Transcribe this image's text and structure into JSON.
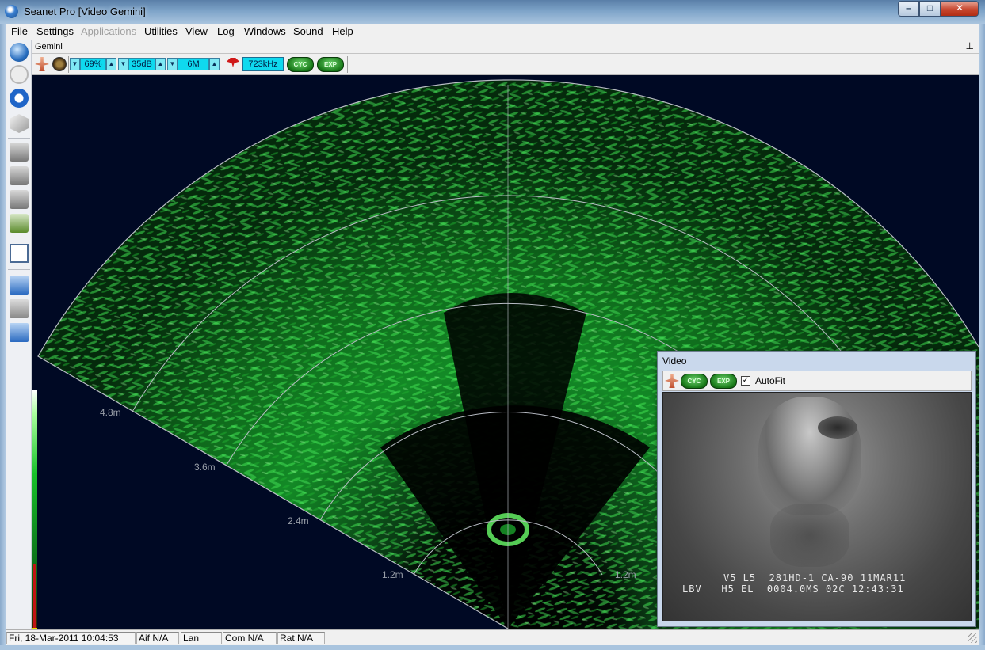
{
  "window": {
    "title": "Seanet Pro [Video Gemini]",
    "min_glyph": "–",
    "max_glyph": "□",
    "close_glyph": "✕"
  },
  "menu": {
    "file": "File",
    "settings": "Settings",
    "applications": "Applications",
    "utilities": "Utilities",
    "view": "View",
    "log": "Log",
    "windows": "Windows",
    "sound": "Sound",
    "help": "Help"
  },
  "left_toolbar": {
    "icons": [
      "globe-icon",
      "disabled-circle-icon",
      "blue-ring-icon",
      "cube-icon",
      "printer-icon",
      "printer-icon",
      "printer-icon",
      "printer-config-icon",
      "window-icon",
      "monitor-icon",
      "monitor-icon",
      "monitor-icon"
    ]
  },
  "gemini": {
    "panel_title": "Gemini",
    "pin_glyph": "⊥",
    "gain": "69%",
    "db": "35dB",
    "range": "6M",
    "frequency": "723kHz",
    "cyc_label": "CYC",
    "exp_label": "EXP",
    "spin_up": "▲",
    "spin_down": "▼"
  },
  "sonar": {
    "range_labels_left": [
      "4.8m",
      "3.6m",
      "2.4m",
      "1.2m"
    ],
    "range_labels_right": [
      "1.2m"
    ],
    "colors": {
      "background": "#000924",
      "echo": "#18c22a",
      "grid": "#b8bcc4"
    }
  },
  "video": {
    "title": "Video",
    "cyc_label": "CYC",
    "exp_label": "EXP",
    "autofit_label": "AutoFit",
    "autofit_checked": "✓",
    "osd_line1": "V5 L5  281HD-1 CA-90 11MAR11",
    "osd_line2": "LBV   H5 EL  0004.0MS 02C 12:43:31"
  },
  "status": {
    "datetime": "Fri, 18-Mar-2011 10:04:53",
    "aif": "Aif N/A",
    "lan": "Lan",
    "com": "Com N/A",
    "rat": "Rat N/A"
  }
}
